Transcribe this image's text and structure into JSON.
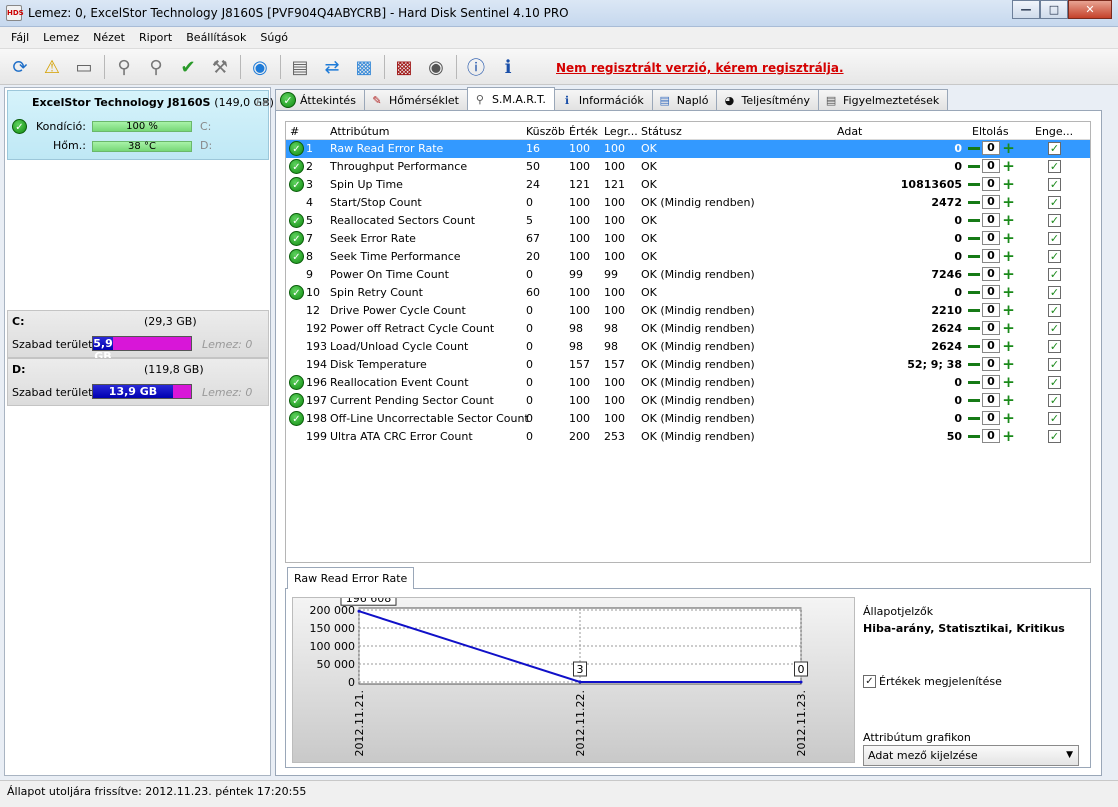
{
  "window": {
    "title": "Lemez: 0, ExcelStor Technology J8160S [PVF904Q4ABYCRB]  -  Hard Disk Sentinel 4.10 PRO",
    "app_icon_text": "HDS"
  },
  "menu": [
    "Fájl",
    "Lemez",
    "Nézet",
    "Riport",
    "Beállítások",
    "Súgó"
  ],
  "toolbar": {
    "register_link": "Nem regisztrált verzió, kérem regisztrálja."
  },
  "disk": {
    "name": "ExcelStor Technology J8160S",
    "size": "(149,0 GB)",
    "truncated": "Le",
    "condition_label": "Kondíció:",
    "condition_value": "100 %",
    "condition_fraction": 1.0,
    "temp_label": "Hőm.:",
    "temp_value": "38 °C",
    "drive_c": "C:",
    "drive_d": "D:"
  },
  "volumes": [
    {
      "letter": "C:",
      "size": "(29,3 GB)",
      "free_label": "Szabad terület",
      "free_value": "5,9 GB",
      "disk_label": "Lemez: 0",
      "free_fraction": 0.2
    },
    {
      "letter": "D:",
      "size": "(119,8 GB)",
      "free_label": "Szabad terület",
      "free_value": "13,9 GB",
      "disk_label": "Lemez: 0",
      "free_fraction": 0.82
    }
  ],
  "tabs": [
    "Áttekintés",
    "Hőmérséklet",
    "S.M.A.R.T.",
    "Információk",
    "Napló",
    "Teljesítmény",
    "Figyelmeztetések"
  ],
  "table": {
    "headers": [
      "#",
      "Attribútum",
      "Küszöb",
      "Érték",
      "Legr...",
      "Státusz",
      "Adat",
      "Eltolás",
      "Enge..."
    ],
    "rows": [
      {
        "ok": true,
        "id": "1",
        "name": "Raw Read Error Rate",
        "thr": "16",
        "val": "100",
        "worst": "100",
        "status": "OK",
        "data": "0",
        "offset": "0",
        "selected": true
      },
      {
        "ok": true,
        "id": "2",
        "name": "Throughput Performance",
        "thr": "50",
        "val": "100",
        "worst": "100",
        "status": "OK",
        "data": "0",
        "offset": "0"
      },
      {
        "ok": true,
        "id": "3",
        "name": "Spin Up Time",
        "thr": "24",
        "val": "121",
        "worst": "121",
        "status": "OK",
        "data": "10813605",
        "offset": "0"
      },
      {
        "ok": false,
        "id": "4",
        "name": "Start/Stop Count",
        "thr": "0",
        "val": "100",
        "worst": "100",
        "status": "OK (Mindig rendben)",
        "data": "2472",
        "offset": "0"
      },
      {
        "ok": true,
        "id": "5",
        "name": "Reallocated Sectors Count",
        "thr": "5",
        "val": "100",
        "worst": "100",
        "status": "OK",
        "data": "0",
        "offset": "0"
      },
      {
        "ok": true,
        "id": "7",
        "name": "Seek Error Rate",
        "thr": "67",
        "val": "100",
        "worst": "100",
        "status": "OK",
        "data": "0",
        "offset": "0"
      },
      {
        "ok": true,
        "id": "8",
        "name": "Seek Time Performance",
        "thr": "20",
        "val": "100",
        "worst": "100",
        "status": "OK",
        "data": "0",
        "offset": "0"
      },
      {
        "ok": false,
        "id": "9",
        "name": "Power On Time Count",
        "thr": "0",
        "val": "99",
        "worst": "99",
        "status": "OK (Mindig rendben)",
        "data": "7246",
        "offset": "0"
      },
      {
        "ok": true,
        "id": "10",
        "name": "Spin Retry Count",
        "thr": "60",
        "val": "100",
        "worst": "100",
        "status": "OK",
        "data": "0",
        "offset": "0"
      },
      {
        "ok": false,
        "id": "12",
        "name": "Drive Power Cycle Count",
        "thr": "0",
        "val": "100",
        "worst": "100",
        "status": "OK (Mindig rendben)",
        "data": "2210",
        "offset": "0"
      },
      {
        "ok": false,
        "id": "192",
        "name": "Power off Retract Cycle Count",
        "thr": "0",
        "val": "98",
        "worst": "98",
        "status": "OK (Mindig rendben)",
        "data": "2624",
        "offset": "0"
      },
      {
        "ok": false,
        "id": "193",
        "name": "Load/Unload Cycle Count",
        "thr": "0",
        "val": "98",
        "worst": "98",
        "status": "OK (Mindig rendben)",
        "data": "2624",
        "offset": "0"
      },
      {
        "ok": false,
        "id": "194",
        "name": "Disk Temperature",
        "thr": "0",
        "val": "157",
        "worst": "157",
        "status": "OK (Mindig rendben)",
        "data": "52; 9; 38",
        "offset": "0"
      },
      {
        "ok": true,
        "id": "196",
        "name": "Reallocation Event Count",
        "thr": "0",
        "val": "100",
        "worst": "100",
        "status": "OK (Mindig rendben)",
        "data": "0",
        "offset": "0"
      },
      {
        "ok": true,
        "id": "197",
        "name": "Current Pending Sector Count",
        "thr": "0",
        "val": "100",
        "worst": "100",
        "status": "OK (Mindig rendben)",
        "data": "0",
        "offset": "0"
      },
      {
        "ok": true,
        "id": "198",
        "name": "Off-Line Uncorrectable Sector Count",
        "thr": "0",
        "val": "100",
        "worst": "100",
        "status": "OK (Mindig rendben)",
        "data": "0",
        "offset": "0"
      },
      {
        "ok": false,
        "id": "199",
        "name": "Ultra ATA CRC Error Count",
        "thr": "0",
        "val": "200",
        "worst": "253",
        "status": "OK (Mindig rendben)",
        "data": "50",
        "offset": "0"
      }
    ]
  },
  "graph": {
    "tab_label": "Raw Read Error Rate",
    "side_title": "Állapotjelzők",
    "side_value": "Hiba-arány, Statisztikai, Kritikus",
    "show_values_label": "Értékek megjelenítése",
    "attr_graph_label": "Attribútum grafikon",
    "select_value": "Adat mező kijelzése"
  },
  "chart_data": {
    "type": "line",
    "x": [
      "2012.11.21.",
      "2012.11.22.",
      "2012.11.23."
    ],
    "series": [
      {
        "values": [
          196608,
          3,
          0
        ]
      }
    ],
    "data_labels": [
      "196 608",
      "3",
      "0"
    ],
    "y_ticks": [
      "200 000",
      "150 000",
      "100 000",
      "50 000",
      "0"
    ],
    "ylim": [
      0,
      200000
    ],
    "grid": true,
    "line_color": "#1010c8"
  },
  "status": {
    "text": "Állapot utoljára frissítve: 2012.11.23. péntek 17:20:55"
  }
}
